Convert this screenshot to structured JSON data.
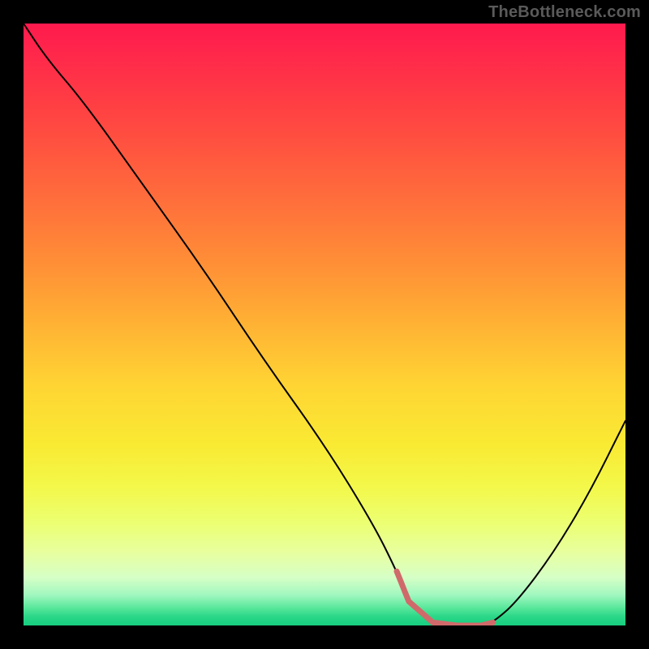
{
  "attribution": "TheBottleneck.com",
  "chart_data": {
    "type": "line",
    "title": "",
    "xlabel": "",
    "ylabel": "",
    "xlim": [
      0,
      100
    ],
    "ylim": [
      0,
      100
    ],
    "x": [
      0,
      4,
      10,
      20,
      30,
      40,
      50,
      58,
      62,
      64,
      68,
      72,
      76,
      78,
      82,
      88,
      94,
      100
    ],
    "values": [
      100,
      94,
      87,
      73,
      59,
      44,
      30,
      17,
      9,
      4,
      0.5,
      0,
      0,
      0.5,
      4,
      12,
      22,
      34
    ],
    "highlight": {
      "x_start": 62,
      "x_end": 78,
      "color": "#d06a6a",
      "thickness": 7
    },
    "gradient_stops": [
      {
        "pos": 0,
        "color": "#ff1a4d"
      },
      {
        "pos": 50,
        "color": "#ffb234"
      },
      {
        "pos": 77,
        "color": "#f3f84a"
      },
      {
        "pos": 100,
        "color": "#16ce7f"
      }
    ]
  }
}
